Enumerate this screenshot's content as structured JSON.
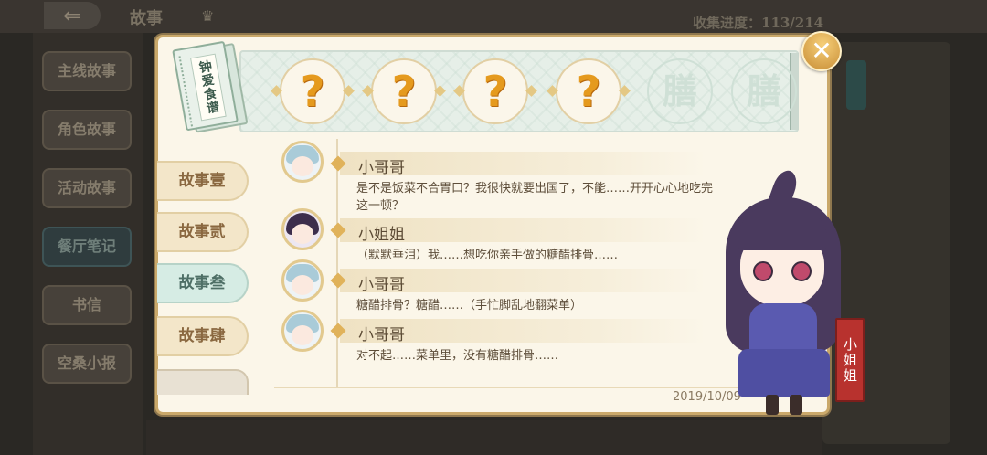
{
  "header": {
    "title": "故事",
    "collect_progress": "收集进度：113/214"
  },
  "side_menu": {
    "items": [
      {
        "label": "主线故事"
      },
      {
        "label": "角色故事"
      },
      {
        "label": "活动故事"
      },
      {
        "label": "餐厅笔记",
        "active": true
      },
      {
        "label": "书信"
      },
      {
        "label": "空桑小报"
      }
    ]
  },
  "book": {
    "title": "钟爱食谱"
  },
  "recipes": {
    "slots": [
      {
        "symbol": "?",
        "state": "unknown"
      },
      {
        "symbol": "?",
        "state": "unknown"
      },
      {
        "symbol": "?",
        "state": "unknown"
      },
      {
        "symbol": "?",
        "state": "unknown"
      },
      {
        "symbol": "膳",
        "state": "locked"
      },
      {
        "symbol": "膳",
        "state": "locked"
      }
    ]
  },
  "chapters": {
    "tabs": [
      {
        "label": "故事壹",
        "active": false
      },
      {
        "label": "故事贰",
        "active": false
      },
      {
        "label": "故事叁",
        "active": true
      },
      {
        "label": "故事肆",
        "active": false
      }
    ]
  },
  "dialogue": {
    "lines": [
      {
        "speaker": "小哥哥",
        "avatar": "boy",
        "text": "是不是饭菜不合胃口？我很快就要出国了，不能……开开心心地吃完这一顿？"
      },
      {
        "speaker": "小姐姐",
        "avatar": "girl",
        "text": "（默默垂泪）我……想吃你亲手做的糖醋排骨……"
      },
      {
        "speaker": "小哥哥",
        "avatar": "boy",
        "text": "糖醋排骨？糖醋……（手忙脚乱地翻菜单）"
      },
      {
        "speaker": "小哥哥",
        "avatar": "boy",
        "text": "对不起……菜单里，没有糖醋排骨……"
      }
    ],
    "date": "2019/10/09"
  },
  "character": {
    "name": "小姐姐"
  },
  "colors": {
    "dialog_bg": "#fbf6e9",
    "gold_border": "#c9a86a",
    "question_orange": "#e59a1e",
    "active_tab": "#d6ece4",
    "name_banner_red": "#b8322e"
  },
  "icons": {
    "back": "back-arrow-icon",
    "close": "close-icon",
    "crown": "crown-icon"
  }
}
